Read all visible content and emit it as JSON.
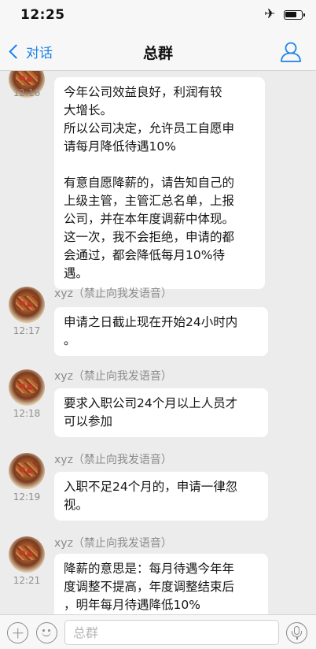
{
  "status_bar": {
    "time": "12:25"
  },
  "nav": {
    "back_label": "对话",
    "title": "总群"
  },
  "messages": [
    {
      "sender": "",
      "time": "12:16",
      "text": "今年公司效益良好，利润有较\n大增长。\n所以公司决定，允许员工自愿申\n请每月降低待遇10%\n\n有意自愿降薪的，请告知自己的\n上级主管，主管汇总名单，上报\n公司，并在本年度调薪中体现。\n这一次，我不会拒绝，申请的都\n会通过，都会降低每月10%待\n遇。"
    },
    {
      "sender": "xyz（禁止向我发语音）",
      "time": "12:17",
      "text": "申请之日截止现在开始24小时内\n。"
    },
    {
      "sender": "xyz（禁止向我发语音）",
      "time": "12:18",
      "text": "要求入职公司24个月以上人员才\n可以参加"
    },
    {
      "sender": "xyz（禁止向我发语音）",
      "time": "12:19",
      "text": "入职不足24个月的，申请一律忽\n视。"
    },
    {
      "sender": "xyz（禁止向我发语音）",
      "time": "12:21",
      "text": "降薪的意思是：每月待遇今年年\n度调整不提高，年度调整结束后\n，明年每月待遇降低10%"
    }
  ],
  "input": {
    "placeholder": "总群"
  },
  "icons": {
    "back": "chevron-left-icon",
    "profile": "person-icon",
    "add": "plus-circle-icon",
    "emoji": "smiley-icon",
    "voice": "microphone-icon",
    "airplane": "airplane-icon",
    "battery": "battery-icon"
  },
  "colors": {
    "accent": "#1e82e8",
    "background": "#ececec",
    "bubble": "#ffffff"
  }
}
